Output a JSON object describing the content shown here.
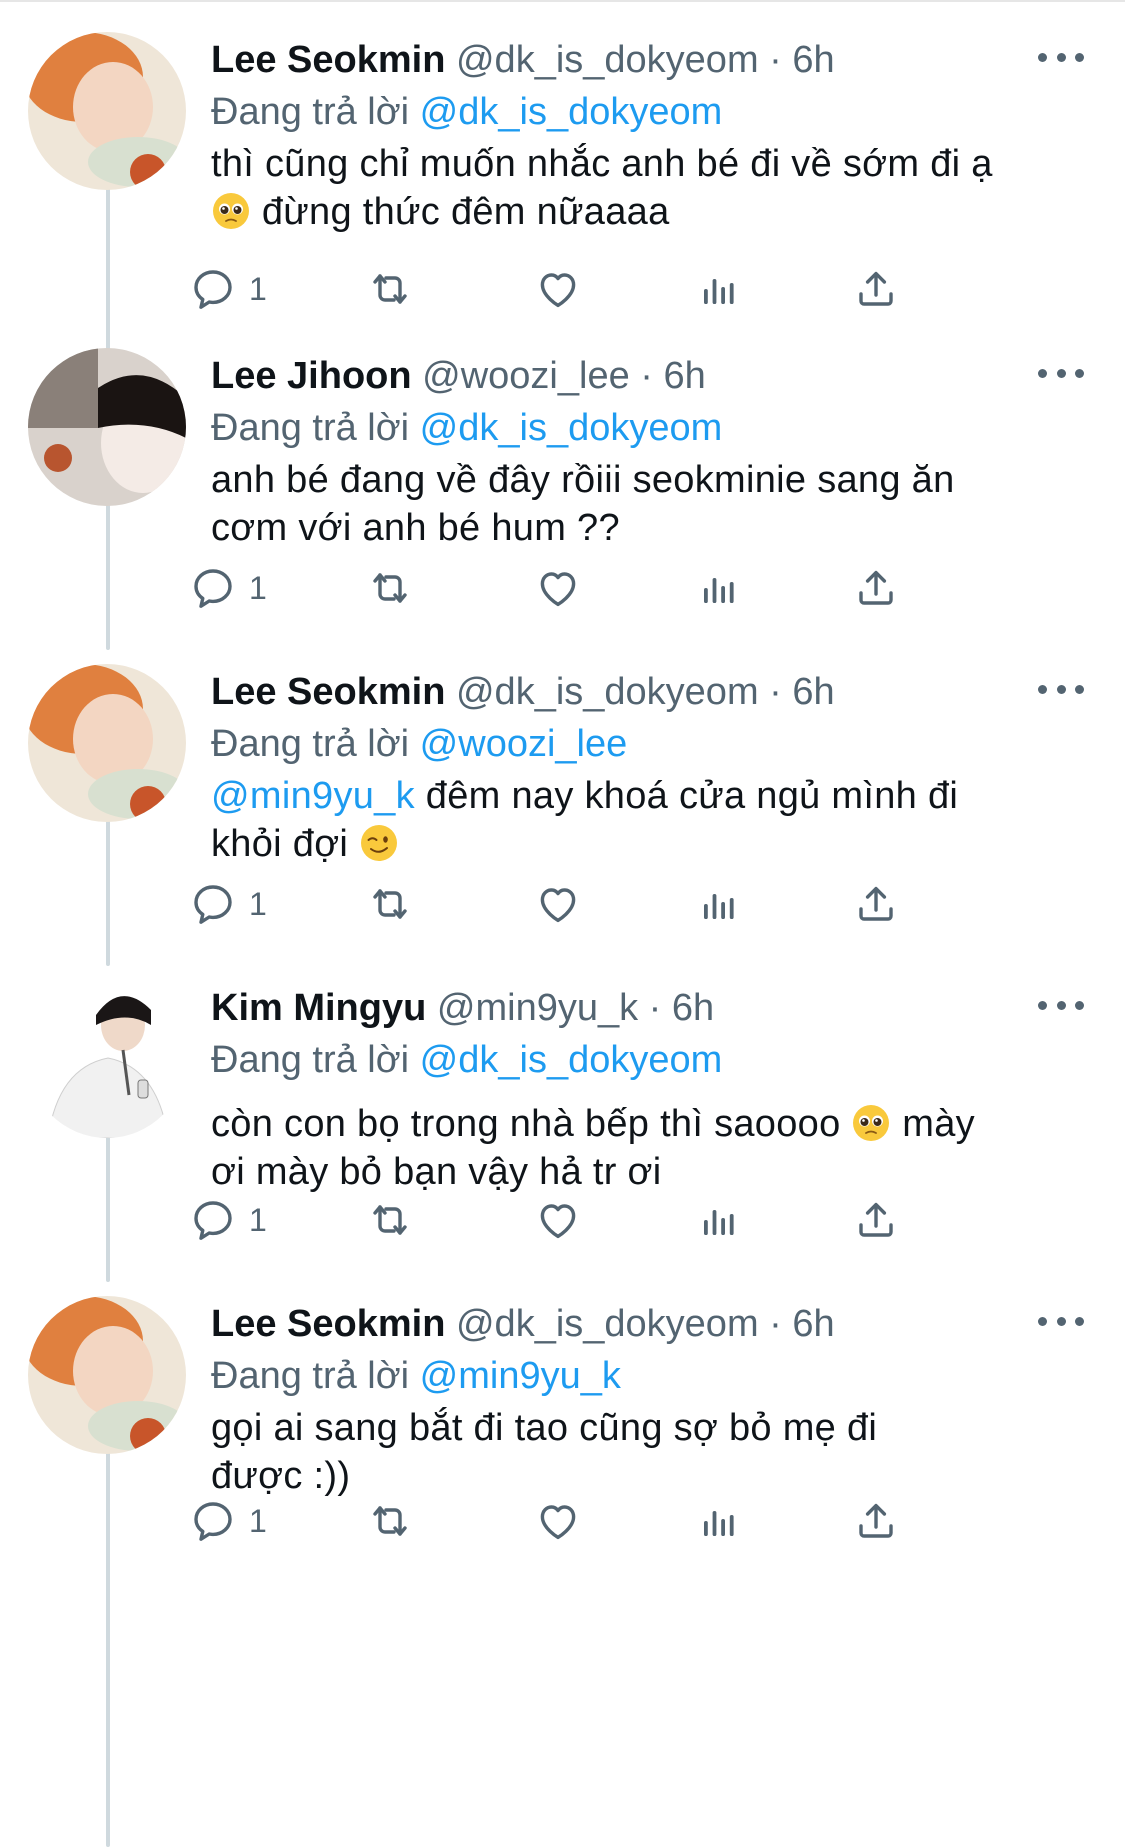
{
  "reply_prefix": "Đang trả lời",
  "colors": {
    "link": "#1d9bf0",
    "muted": "#536471",
    "text": "#0f1419",
    "thread_line": "#cfd9de"
  },
  "icons": [
    "reply-icon",
    "retweet-icon",
    "like-icon",
    "analytics-icon",
    "share-icon",
    "more-icon"
  ],
  "tweets": [
    {
      "name": "Lee Seokmin",
      "handle": "@dk_is_dokyeom",
      "separator": "·",
      "time": "6h",
      "reply_to": "@dk_is_dokyeom",
      "body_parts": [
        "thì cũng chỉ muốn nhắc anh bé đi về sớm đi ạ",
        "đừng thức đêm nữaaaa"
      ],
      "emoji": "pleading-face",
      "reply_count": "1"
    },
    {
      "name": "Lee Jihoon",
      "handle": "@woozi_lee",
      "separator": "·",
      "time": "6h",
      "reply_to": "@dk_is_dokyeom",
      "body_parts": [
        "anh bé đang về đây rồiii seokminie sang ăn cơm với anh bé hum ??"
      ],
      "reply_count": "1"
    },
    {
      "name": "Lee Seokmin",
      "handle": "@dk_is_dokyeom",
      "separator": "·",
      "time": "6h",
      "reply_to": "@woozi_lee",
      "body_mention": "@min9yu_k",
      "body_parts": [
        " đêm nay khoá cửa ngủ mình đi",
        "khỏi đợi"
      ],
      "emoji": "winking-face",
      "reply_count": "1"
    },
    {
      "name": "Kim Mingyu",
      "handle": "@min9yu_k",
      "separator": "·",
      "time": "6h",
      "reply_to": "@dk_is_dokyeom",
      "body_parts": [
        "còn con bọ trong nhà bếp thì saoooo",
        " mày",
        "ơi mày bỏ bạn vậy hả tr ơi"
      ],
      "emoji": "pleading-face",
      "reply_count": "1"
    },
    {
      "name": "Lee Seokmin",
      "handle": "@dk_is_dokyeom",
      "separator": "·",
      "time": "6h",
      "reply_to": "@min9yu_k",
      "body_parts": [
        "gọi ai sang bắt đi tao cũng sợ bỏ mẹ đi",
        "được :))"
      ],
      "reply_count": "1"
    }
  ]
}
